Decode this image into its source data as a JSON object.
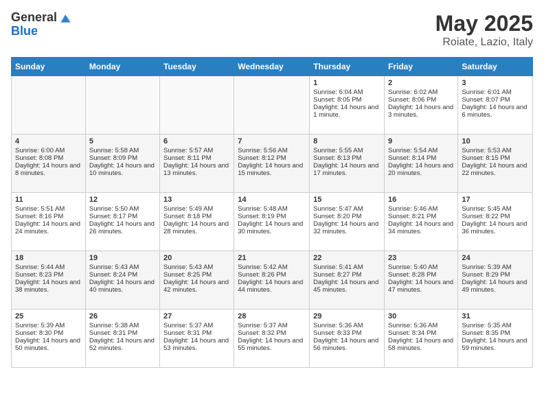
{
  "header": {
    "logo_general": "General",
    "logo_blue": "Blue",
    "month": "May 2025",
    "location": "Roiate, Lazio, Italy"
  },
  "days_of_week": [
    "Sunday",
    "Monday",
    "Tuesday",
    "Wednesday",
    "Thursday",
    "Friday",
    "Saturday"
  ],
  "weeks": [
    [
      {
        "day": "",
        "sunrise": "",
        "sunset": "",
        "daylight": ""
      },
      {
        "day": "",
        "sunrise": "",
        "sunset": "",
        "daylight": ""
      },
      {
        "day": "",
        "sunrise": "",
        "sunset": "",
        "daylight": ""
      },
      {
        "day": "",
        "sunrise": "",
        "sunset": "",
        "daylight": ""
      },
      {
        "day": "1",
        "sunrise": "Sunrise: 6:04 AM",
        "sunset": "Sunset: 8:05 PM",
        "daylight": "Daylight: 14 hours and 1 minute."
      },
      {
        "day": "2",
        "sunrise": "Sunrise: 6:02 AM",
        "sunset": "Sunset: 8:06 PM",
        "daylight": "Daylight: 14 hours and 3 minutes."
      },
      {
        "day": "3",
        "sunrise": "Sunrise: 6:01 AM",
        "sunset": "Sunset: 8:07 PM",
        "daylight": "Daylight: 14 hours and 6 minutes."
      }
    ],
    [
      {
        "day": "4",
        "sunrise": "Sunrise: 6:00 AM",
        "sunset": "Sunset: 8:08 PM",
        "daylight": "Daylight: 14 hours and 8 minutes."
      },
      {
        "day": "5",
        "sunrise": "Sunrise: 5:58 AM",
        "sunset": "Sunset: 8:09 PM",
        "daylight": "Daylight: 14 hours and 10 minutes."
      },
      {
        "day": "6",
        "sunrise": "Sunrise: 5:57 AM",
        "sunset": "Sunset: 8:11 PM",
        "daylight": "Daylight: 14 hours and 13 minutes."
      },
      {
        "day": "7",
        "sunrise": "Sunrise: 5:56 AM",
        "sunset": "Sunset: 8:12 PM",
        "daylight": "Daylight: 14 hours and 15 minutes."
      },
      {
        "day": "8",
        "sunrise": "Sunrise: 5:55 AM",
        "sunset": "Sunset: 8:13 PM",
        "daylight": "Daylight: 14 hours and 17 minutes."
      },
      {
        "day": "9",
        "sunrise": "Sunrise: 5:54 AM",
        "sunset": "Sunset: 8:14 PM",
        "daylight": "Daylight: 14 hours and 20 minutes."
      },
      {
        "day": "10",
        "sunrise": "Sunrise: 5:53 AM",
        "sunset": "Sunset: 8:15 PM",
        "daylight": "Daylight: 14 hours and 22 minutes."
      }
    ],
    [
      {
        "day": "11",
        "sunrise": "Sunrise: 5:51 AM",
        "sunset": "Sunset: 8:16 PM",
        "daylight": "Daylight: 14 hours and 24 minutes."
      },
      {
        "day": "12",
        "sunrise": "Sunrise: 5:50 AM",
        "sunset": "Sunset: 8:17 PM",
        "daylight": "Daylight: 14 hours and 26 minutes."
      },
      {
        "day": "13",
        "sunrise": "Sunrise: 5:49 AM",
        "sunset": "Sunset: 8:18 PM",
        "daylight": "Daylight: 14 hours and 28 minutes."
      },
      {
        "day": "14",
        "sunrise": "Sunrise: 5:48 AM",
        "sunset": "Sunset: 8:19 PM",
        "daylight": "Daylight: 14 hours and 30 minutes."
      },
      {
        "day": "15",
        "sunrise": "Sunrise: 5:47 AM",
        "sunset": "Sunset: 8:20 PM",
        "daylight": "Daylight: 14 hours and 32 minutes."
      },
      {
        "day": "16",
        "sunrise": "Sunrise: 5:46 AM",
        "sunset": "Sunset: 8:21 PM",
        "daylight": "Daylight: 14 hours and 34 minutes."
      },
      {
        "day": "17",
        "sunrise": "Sunrise: 5:45 AM",
        "sunset": "Sunset: 8:22 PM",
        "daylight": "Daylight: 14 hours and 36 minutes."
      }
    ],
    [
      {
        "day": "18",
        "sunrise": "Sunrise: 5:44 AM",
        "sunset": "Sunset: 8:23 PM",
        "daylight": "Daylight: 14 hours and 38 minutes."
      },
      {
        "day": "19",
        "sunrise": "Sunrise: 5:43 AM",
        "sunset": "Sunset: 8:24 PM",
        "daylight": "Daylight: 14 hours and 40 minutes."
      },
      {
        "day": "20",
        "sunrise": "Sunrise: 5:43 AM",
        "sunset": "Sunset: 8:25 PM",
        "daylight": "Daylight: 14 hours and 42 minutes."
      },
      {
        "day": "21",
        "sunrise": "Sunrise: 5:42 AM",
        "sunset": "Sunset: 8:26 PM",
        "daylight": "Daylight: 14 hours and 44 minutes."
      },
      {
        "day": "22",
        "sunrise": "Sunrise: 5:41 AM",
        "sunset": "Sunset: 8:27 PM",
        "daylight": "Daylight: 14 hours and 45 minutes."
      },
      {
        "day": "23",
        "sunrise": "Sunrise: 5:40 AM",
        "sunset": "Sunset: 8:28 PM",
        "daylight": "Daylight: 14 hours and 47 minutes."
      },
      {
        "day": "24",
        "sunrise": "Sunrise: 5:39 AM",
        "sunset": "Sunset: 8:29 PM",
        "daylight": "Daylight: 14 hours and 49 minutes."
      }
    ],
    [
      {
        "day": "25",
        "sunrise": "Sunrise: 5:39 AM",
        "sunset": "Sunset: 8:30 PM",
        "daylight": "Daylight: 14 hours and 50 minutes."
      },
      {
        "day": "26",
        "sunrise": "Sunrise: 5:38 AM",
        "sunset": "Sunset: 8:31 PM",
        "daylight": "Daylight: 14 hours and 52 minutes."
      },
      {
        "day": "27",
        "sunrise": "Sunrise: 5:37 AM",
        "sunset": "Sunset: 8:31 PM",
        "daylight": "Daylight: 14 hours and 53 minutes."
      },
      {
        "day": "28",
        "sunrise": "Sunrise: 5:37 AM",
        "sunset": "Sunset: 8:32 PM",
        "daylight": "Daylight: 14 hours and 55 minutes."
      },
      {
        "day": "29",
        "sunrise": "Sunrise: 5:36 AM",
        "sunset": "Sunset: 8:33 PM",
        "daylight": "Daylight: 14 hours and 56 minutes."
      },
      {
        "day": "30",
        "sunrise": "Sunrise: 5:36 AM",
        "sunset": "Sunset: 8:34 PM",
        "daylight": "Daylight: 14 hours and 58 minutes."
      },
      {
        "day": "31",
        "sunrise": "Sunrise: 5:35 AM",
        "sunset": "Sunset: 8:35 PM",
        "daylight": "Daylight: 14 hours and 59 minutes."
      }
    ]
  ]
}
